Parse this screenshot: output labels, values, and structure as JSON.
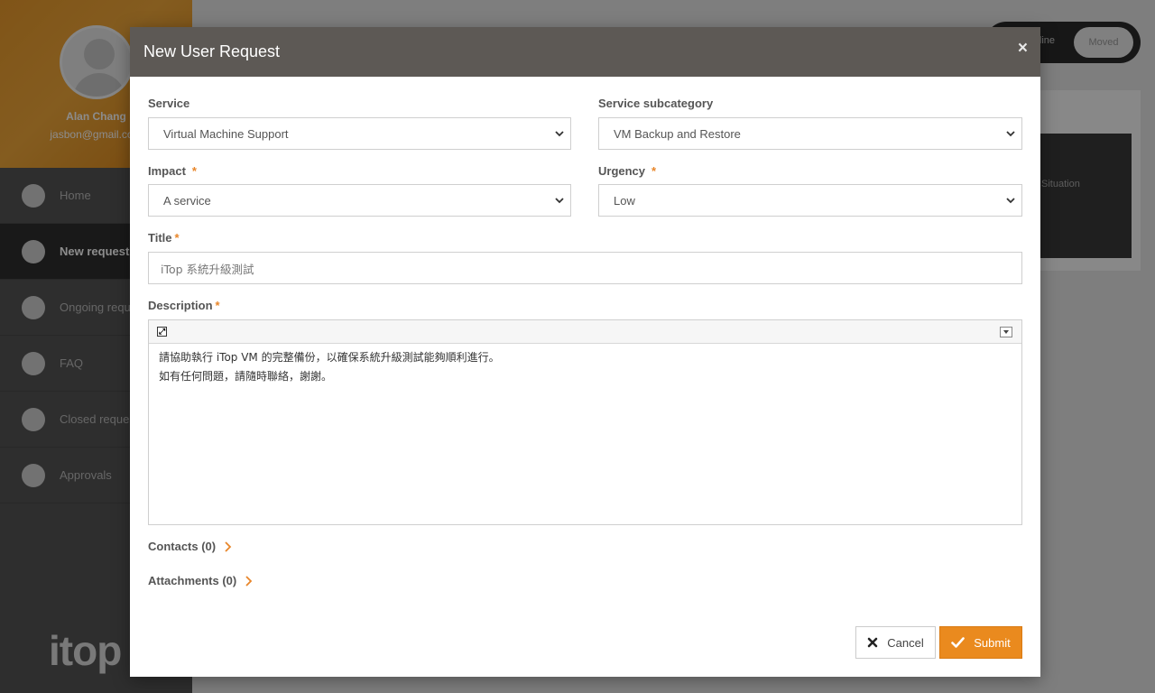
{
  "background": {
    "profile": {
      "name": "Alan Chang",
      "email": "jasbon@gmail.com"
    },
    "nav": [
      {
        "label": "Home",
        "icon": "home-icon"
      },
      {
        "label": "New request",
        "icon": "plus-circle-icon"
      },
      {
        "label": "Ongoing requests",
        "icon": "ongoing-icon"
      },
      {
        "label": "FAQ",
        "icon": "faq-icon"
      },
      {
        "label": "Closed requests",
        "icon": "closed-icon"
      },
      {
        "label": "Approvals",
        "icon": "check-circle-icon"
      }
    ],
    "logo_text": "itop",
    "topbar": {
      "pill_text": "ffline",
      "pill_button": "Moved"
    },
    "side_card_text": "Situation"
  },
  "modal": {
    "title": "New User Request",
    "close_symbol": "×",
    "fields": {
      "service": {
        "label": "Service",
        "value": "Virtual Machine Support"
      },
      "subcategory": {
        "label": "Service subcategory",
        "value": "VM Backup and Restore"
      },
      "impact": {
        "label": "Impact",
        "required": "*",
        "value": "A service"
      },
      "urgency": {
        "label": "Urgency",
        "required": "*",
        "value": "Low"
      },
      "title": {
        "label": "Title",
        "required": "*",
        "value": "iTop 系統升級測試"
      },
      "description": {
        "label": "Description",
        "required": "*",
        "lines": [
          "請協助執行 iTop VM 的完整備份，以確保系統升級測試能夠順利進行。",
          "如有任何問題，請隨時聯絡，謝謝。"
        ]
      }
    },
    "sections": {
      "contacts": "Contacts (0)",
      "attachments": "Attachments (0)"
    },
    "buttons": {
      "cancel": "Cancel",
      "submit": "Submit"
    },
    "colors": {
      "accent": "#ea8a1e",
      "header": "#5d5955",
      "required": "#e8862a"
    }
  }
}
